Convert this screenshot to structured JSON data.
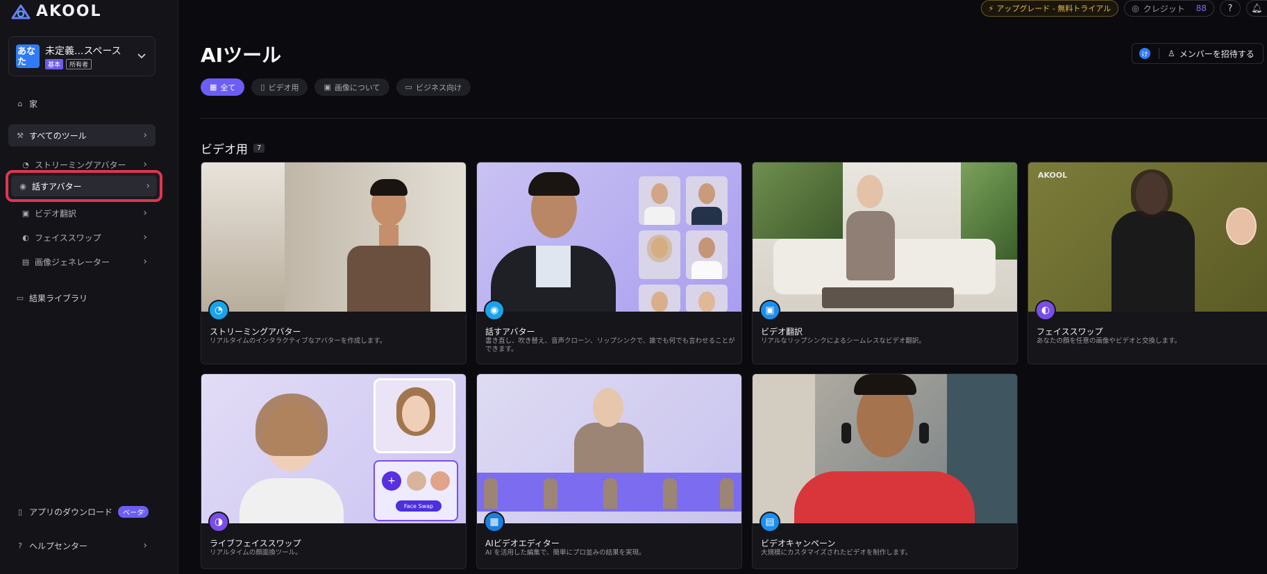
{
  "app": {
    "brand": "AKOOL"
  },
  "workspace": {
    "avatar_text": "あなた",
    "name": "未定義...スペース",
    "plan_badge": "基本",
    "role_badge": "所有者"
  },
  "sidebar": {
    "home": "家",
    "all_tools": "すべてのツール",
    "sub_items": [
      {
        "label": "ストリーミングアバター",
        "icon": "streaming-icon"
      },
      {
        "label": "話すアバター",
        "icon": "avatar-icon"
      },
      {
        "label": "ビデオ翻訳",
        "icon": "translate-icon"
      },
      {
        "label": "フェイススワップ",
        "icon": "faceswap-icon"
      },
      {
        "label": "画像ジェネレーター",
        "icon": "image-icon"
      }
    ],
    "library": "結果ライブラリ",
    "download_app": "アプリのダウンロード",
    "beta_badge": "ベータ",
    "help_center": "ヘルプセンター"
  },
  "topbar": {
    "upgrade": "アップグレード - 無料トライアル",
    "credits_label": "クレジット",
    "credits_value": "88",
    "help": "?"
  },
  "header": {
    "title": "AIツール",
    "lang_chip": "け",
    "invite": "メンバーを招待する"
  },
  "filters": [
    {
      "label": "全て",
      "active": true
    },
    {
      "label": "ビデオ用"
    },
    {
      "label": "画像について"
    },
    {
      "label": "ビジネス向け"
    }
  ],
  "section": {
    "title": "ビデオ用",
    "count": "7"
  },
  "cards": [
    {
      "title": "ストリーミングアバター",
      "desc": "リアルタイムのインタラクティブなアバターを作成します。",
      "accent": "#1aa3e8"
    },
    {
      "title": "話すアバター",
      "desc": "書き直し、吹き替え、音声クローン、リップシンクで、誰でも何でも言わせることができます。",
      "accent": "#1aa3e8"
    },
    {
      "title": "ビデオ翻訳",
      "desc": "リアルなリップシンクによるシームレスなビデオ翻訳。",
      "accent": "#1a8ff0"
    },
    {
      "title": "フェイススワップ",
      "desc": "あなたの顔を任意の画像やビデオと交換します。",
      "accent": "#7a4de8"
    },
    {
      "title": "ライブフェイススワップ",
      "desc": "リアルタイムの顔面換ツール。",
      "accent": "#7a4de8"
    },
    {
      "title": "AIビデオエディター",
      "desc": "AI を活用した編集で、簡単にプロ並みの結果を実現。",
      "accent": "#1a7fe0"
    },
    {
      "title": "ビデオキャンペーン",
      "desc": "大規模にカスタマイズされたビデオを制作します。",
      "accent": "#1a8ff0"
    }
  ],
  "faceswap_badge": "Face Swap",
  "faceswap_plus": "+"
}
